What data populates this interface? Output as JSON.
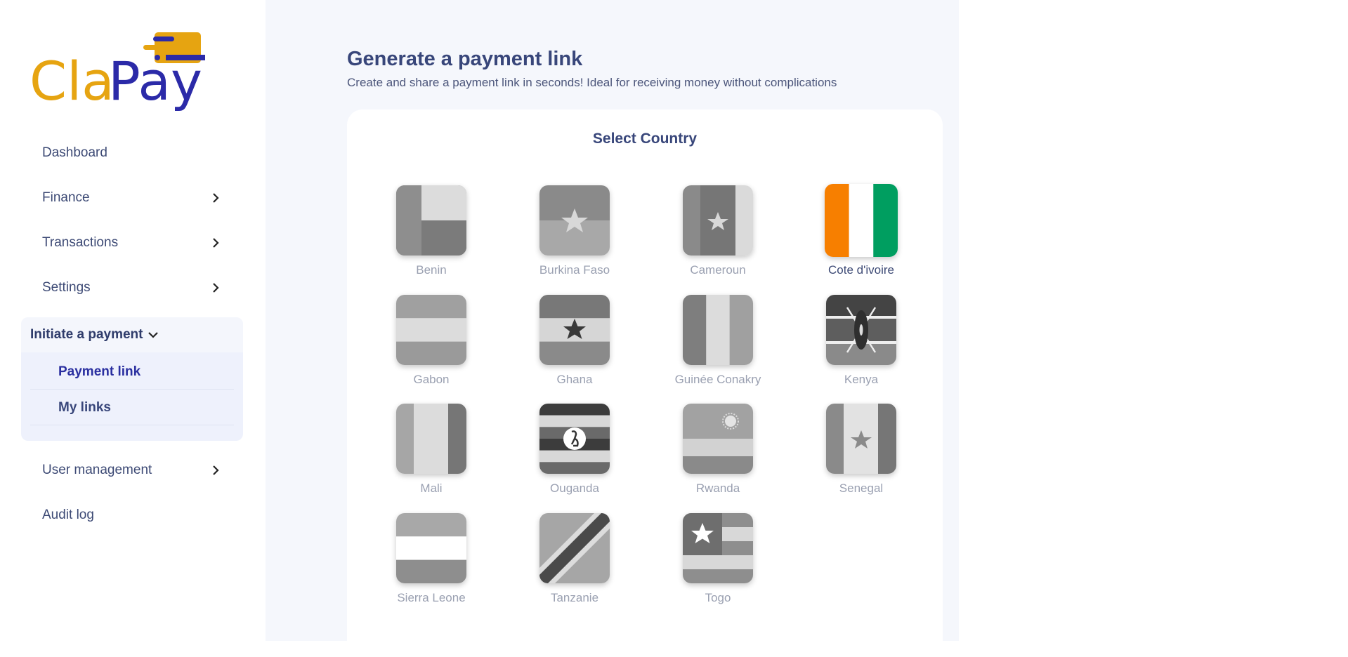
{
  "brand": {
    "name": "ClaPay",
    "part1": "Cla",
    "part2": "Pay",
    "color1": "#e8a317",
    "color2": "#2b2aa8"
  },
  "sidebar": {
    "items": [
      {
        "label": "Dashboard",
        "has_chevron": false
      },
      {
        "label": "Finance",
        "has_chevron": true
      },
      {
        "label": "Transactions",
        "has_chevron": true
      },
      {
        "label": "Settings",
        "has_chevron": true
      }
    ],
    "group": {
      "label": "Initiate a payment",
      "expanded": true,
      "sub_items": [
        {
          "label": "Payment link",
          "active": true
        },
        {
          "label": "My links",
          "active": false
        }
      ]
    },
    "bottom_items": [
      {
        "label": "User management",
        "has_chevron": true
      },
      {
        "label": "Audit log",
        "has_chevron": false
      }
    ]
  },
  "main": {
    "title": "Generate a payment link",
    "subtitle": "Create and share a payment link in seconds! Ideal for receiving money without complications",
    "card_title": "Select Country",
    "countries": [
      {
        "name": "Benin",
        "selected": false
      },
      {
        "name": "Burkina Faso",
        "selected": false
      },
      {
        "name": "Cameroun",
        "selected": false
      },
      {
        "name": "Cote d'ivoire",
        "selected": true
      },
      {
        "name": "Gabon",
        "selected": false
      },
      {
        "name": "Ghana",
        "selected": false
      },
      {
        "name": "Guinée Conakry",
        "selected": false
      },
      {
        "name": "Kenya",
        "selected": false
      },
      {
        "name": "Mali",
        "selected": false
      },
      {
        "name": "Ouganda",
        "selected": false
      },
      {
        "name": "Rwanda",
        "selected": false
      },
      {
        "name": "Senegal",
        "selected": false
      },
      {
        "name": "Sierra Leone",
        "selected": false
      },
      {
        "name": "Tanzanie",
        "selected": false
      },
      {
        "name": "Togo",
        "selected": false
      }
    ]
  },
  "colors": {
    "text_dark": "#38467a",
    "active_link": "#2a2fa0",
    "muted": "#9aa0b1",
    "accent": "#2b2aa8"
  }
}
